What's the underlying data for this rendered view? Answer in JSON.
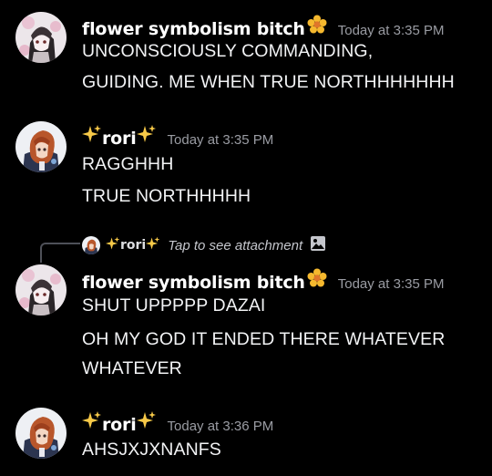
{
  "messages": [
    {
      "username": "flower symbolism bitch",
      "timestamp": "Today at 3:35 PM",
      "lines": [
        "UNCONSCIOUSLY COMMANDING,",
        "GUIDING. ME WHEN TRUE NORTHHHHHHH"
      ]
    },
    {
      "username": "rori",
      "timestamp": "Today at 3:35 PM",
      "lines": [
        "RAGGHHH",
        "TRUE NORTHHHHH"
      ]
    },
    {
      "reply": {
        "username": "rori",
        "text": "Tap to see attachment"
      },
      "username": "flower symbolism bitch",
      "timestamp": "Today at 3:35 PM",
      "lines": [
        "SHUT UPPPPP DAZAI",
        "OH MY GOD IT ENDED THERE WHATEVER",
        "WHATEVER"
      ]
    },
    {
      "username": "rori",
      "timestamp": "Today at 3:36 PM",
      "lines": [
        "AHSJXJXNANFS"
      ]
    }
  ],
  "icons": {
    "flower": "blossom-emoji-icon",
    "sparkles": "sparkles-emoji-icon",
    "attachment": "image-icon"
  },
  "colors": {
    "background": "#000000",
    "timestamp": "#9a9ca3",
    "text": "#f2f3f5",
    "flower": "#f5b82e",
    "sparkles": "#f7c948"
  }
}
